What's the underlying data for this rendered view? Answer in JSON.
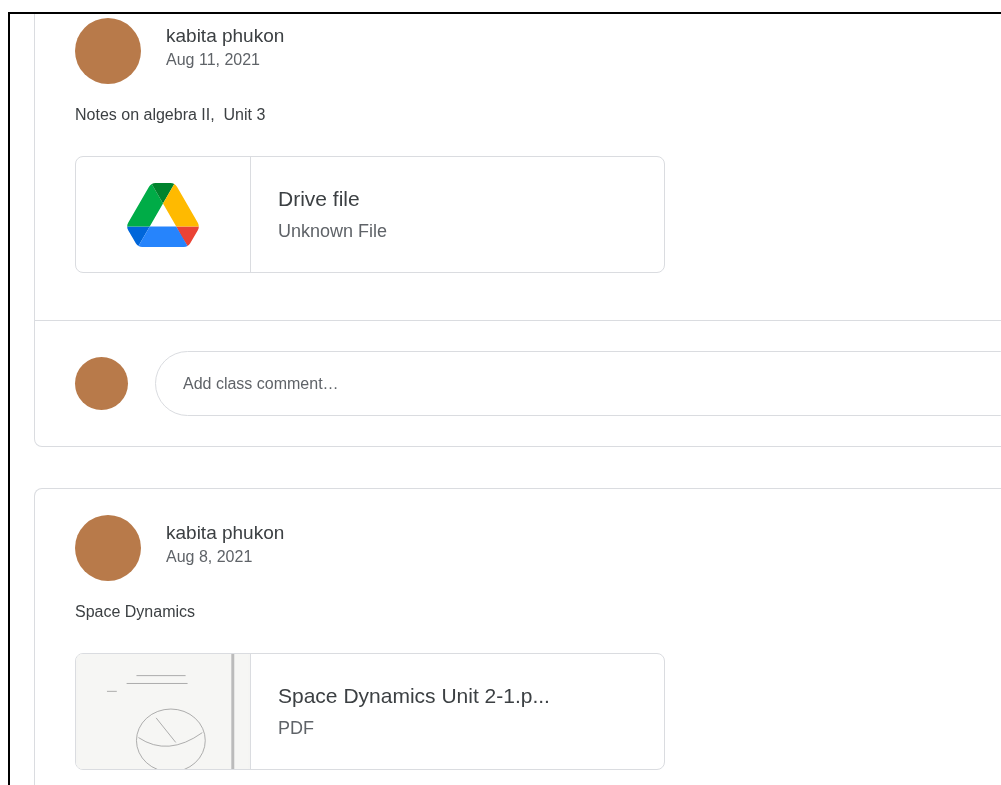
{
  "posts": [
    {
      "author": "kabita phukon",
      "date": "Aug 11, 2021",
      "text": "Notes on algebra II,  Unit 3",
      "attachment": {
        "kind": "drive",
        "title": "Drive file",
        "subtitle": "Unknown File"
      },
      "comment": {
        "placeholder": "Add class comment…"
      }
    },
    {
      "author": "kabita phukon",
      "date": "Aug 8, 2021",
      "text": "Space Dynamics",
      "attachment": {
        "kind": "pdf",
        "title": "Space Dynamics Unit 2-1.p...",
        "subtitle": "PDF"
      }
    }
  ]
}
